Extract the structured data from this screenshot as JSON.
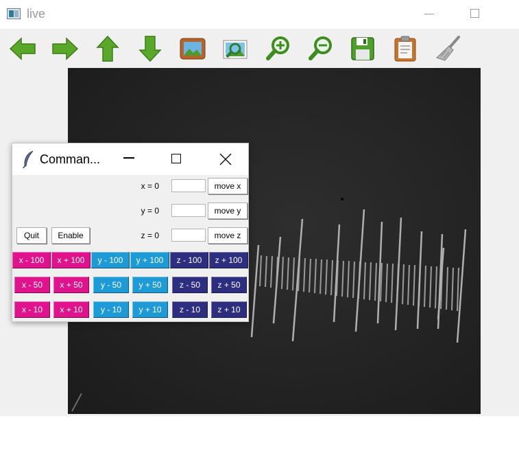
{
  "main_window": {
    "title": "live"
  },
  "toolbar": {
    "buttons": [
      {
        "name": "back-arrow-icon"
      },
      {
        "name": "forward-arrow-icon"
      },
      {
        "name": "up-arrow-icon"
      },
      {
        "name": "down-arrow-icon"
      },
      {
        "name": "image-icon"
      },
      {
        "name": "zoom-image-icon"
      },
      {
        "name": "zoom-in-icon"
      },
      {
        "name": "zoom-out-icon"
      },
      {
        "name": "save-icon"
      },
      {
        "name": "clipboard-icon"
      },
      {
        "name": "clear-broom-icon"
      }
    ]
  },
  "command_window": {
    "title": "Comman...",
    "x_label": "x = 0",
    "y_label": "y = 0",
    "z_label": "z = 0",
    "x_value": "",
    "y_value": "",
    "z_value": "",
    "move_x": "move x",
    "move_y": "move y",
    "move_z": "move z",
    "quit": "Quit",
    "enable": "Enable",
    "jog_rows": [
      [
        "x - 100",
        "x + 100",
        "y - 100",
        "y + 100",
        "z - 100",
        "z + 100"
      ],
      [
        "x - 50",
        "x + 50",
        "y - 50",
        "y + 50",
        "z - 50",
        "z + 50"
      ],
      [
        "x - 10",
        "x + 10",
        "y - 10",
        "y + 10",
        "z - 10",
        "z + 10"
      ]
    ]
  },
  "colors": {
    "x": "#e0138c",
    "y": "#1e9ad6",
    "z": "#2e2e80"
  }
}
